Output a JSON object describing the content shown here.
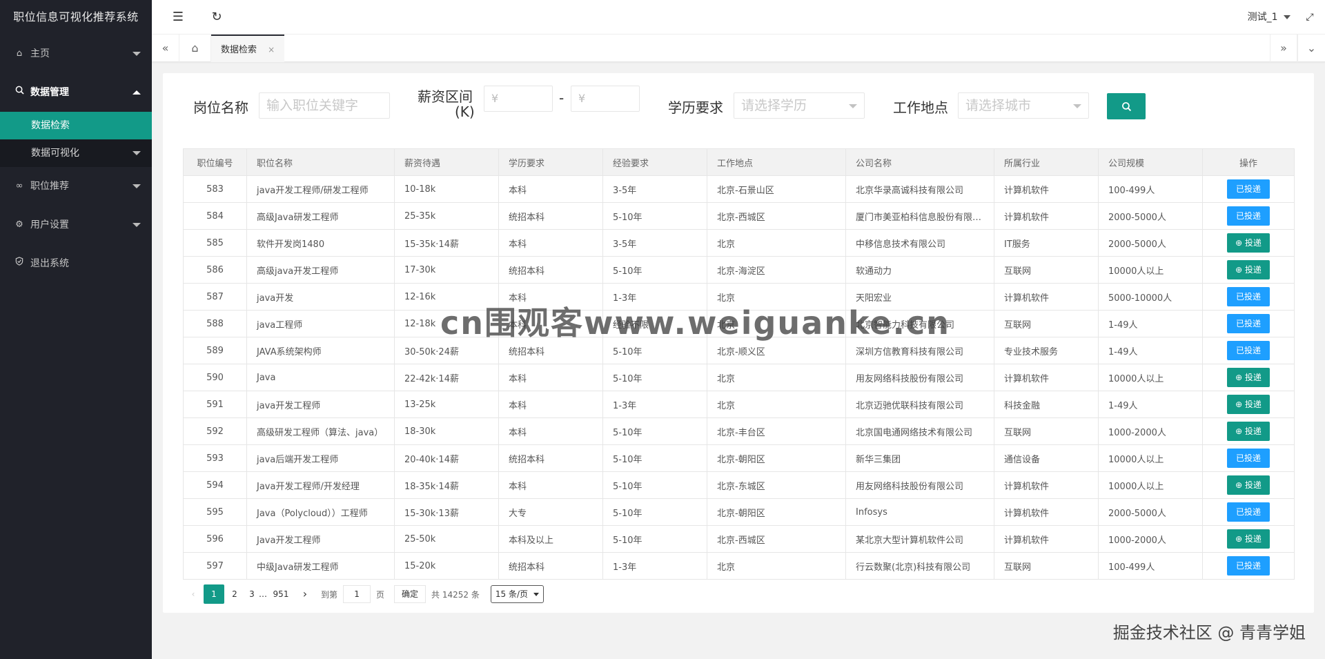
{
  "brand": "职位信息可视化推荐系统",
  "sidebar": {
    "items": [
      {
        "label": "主页",
        "icon": "home-icon"
      },
      {
        "label": "数据管理",
        "icon": "search-icon"
      },
      {
        "label": "职位推荐",
        "icon": "link-icon"
      },
      {
        "label": "用户设置",
        "icon": "gear-icon"
      },
      {
        "label": "退出系统",
        "icon": "shield-icon"
      }
    ],
    "sub": {
      "active": "数据检索",
      "second": "数据可视化"
    }
  },
  "header": {
    "user": "测试_1"
  },
  "tabs": {
    "active": "数据检索",
    "close": "×"
  },
  "filter": {
    "job_label": "岗位名称",
    "job_placeholder": "输入职位关键字",
    "salary_label_1": "薪资区间",
    "salary_label_2": "(K)",
    "salary_min_placeholder": "¥",
    "salary_max_placeholder": "¥",
    "dash": "-",
    "edu_label": "学历要求",
    "edu_placeholder": "请选择学历",
    "city_label": "工作地点",
    "city_placeholder": "请选择城市"
  },
  "table": {
    "headers": [
      "职位编号",
      "职位名称",
      "薪资待遇",
      "学历要求",
      "经验要求",
      "工作地点",
      "公司名称",
      "所属行业",
      "公司规模",
      "操作"
    ],
    "sent_label": "已投递",
    "apply_label": "⊕ 投递",
    "rows": [
      {
        "id": "583",
        "name": "java开发工程师/研发工程师",
        "salary": "10-18k",
        "edu": "本科",
        "exp": "3-5年",
        "city": "北京-石景山区",
        "company": "北京华录高诚科技有限公司",
        "industry": "计算机软件",
        "size": "100-499人",
        "status": "sent"
      },
      {
        "id": "584",
        "name": "高级Java研发工程师",
        "salary": "25-35k",
        "edu": "统招本科",
        "exp": "5-10年",
        "city": "北京-西城区",
        "company": "厦门市美亚柏科信息股份有限公司",
        "industry": "计算机软件",
        "size": "2000-5000人",
        "status": "sent"
      },
      {
        "id": "585",
        "name": "软件开发岗1480",
        "salary": "15-35k·14薪",
        "edu": "本科",
        "exp": "3-5年",
        "city": "北京",
        "company": "中移信息技术有限公司",
        "industry": "IT服务",
        "size": "2000-5000人",
        "status": "apply"
      },
      {
        "id": "586",
        "name": "高级java开发工程师",
        "salary": "17-30k",
        "edu": "统招本科",
        "exp": "5-10年",
        "city": "北京-海淀区",
        "company": "软通动力",
        "industry": "互联网",
        "size": "10000人以上",
        "status": "apply"
      },
      {
        "id": "587",
        "name": "java开发",
        "salary": "12-16k",
        "edu": "本科",
        "exp": "1-3年",
        "city": "北京",
        "company": "天阳宏业",
        "industry": "计算机软件",
        "size": "5000-10000人",
        "status": "sent"
      },
      {
        "id": "588",
        "name": "java工程师",
        "salary": "12-18k",
        "edu": "本科",
        "exp": "经验不限",
        "city": "北京",
        "company": "北京智能力科技有限公司",
        "industry": "互联网",
        "size": "1-49人",
        "status": "sent"
      },
      {
        "id": "589",
        "name": "JAVA系统架构师",
        "salary": "30-50k·24薪",
        "edu": "统招本科",
        "exp": "5-10年",
        "city": "北京-顺义区",
        "company": "深圳方信教育科技有限公司",
        "industry": "专业技术服务",
        "size": "1-49人",
        "status": "sent"
      },
      {
        "id": "590",
        "name": "Java",
        "salary": "22-42k·14薪",
        "edu": "本科",
        "exp": "5-10年",
        "city": "北京",
        "company": "用友网络科技股份有限公司",
        "industry": "计算机软件",
        "size": "10000人以上",
        "status": "apply"
      },
      {
        "id": "591",
        "name": "java开发工程师",
        "salary": "13-25k",
        "edu": "本科",
        "exp": "1-3年",
        "city": "北京",
        "company": "北京迈驰优联科技有限公司",
        "industry": "科技金融",
        "size": "1-49人",
        "status": "apply"
      },
      {
        "id": "592",
        "name": "高级研发工程师（算法、java）",
        "salary": "18-30k",
        "edu": "本科",
        "exp": "5-10年",
        "city": "北京-丰台区",
        "company": "北京国电通网络技术有限公司",
        "industry": "互联网",
        "size": "1000-2000人",
        "status": "apply"
      },
      {
        "id": "593",
        "name": "java后端开发工程师",
        "salary": "20-40k·14薪",
        "edu": "统招本科",
        "exp": "5-10年",
        "city": "北京-朝阳区",
        "company": "新华三集团",
        "industry": "通信设备",
        "size": "10000人以上",
        "status": "sent"
      },
      {
        "id": "594",
        "name": "Java开发工程师/开发经理",
        "salary": "18-35k·14薪",
        "edu": "本科",
        "exp": "5-10年",
        "city": "北京-东城区",
        "company": "用友网络科技股份有限公司",
        "industry": "计算机软件",
        "size": "10000人以上",
        "status": "apply"
      },
      {
        "id": "595",
        "name": "Java（Polycloud））工程师",
        "salary": "15-30k·13薪",
        "edu": "大专",
        "exp": "5-10年",
        "city": "北京-朝阳区",
        "company": "Infosys",
        "industry": "计算机软件",
        "size": "2000-5000人",
        "status": "sent"
      },
      {
        "id": "596",
        "name": "Java开发工程师",
        "salary": "25-50k",
        "edu": "本科及以上",
        "exp": "5-10年",
        "city": "北京-西城区",
        "company": "某北京大型计算机软件公司",
        "industry": "计算机软件",
        "size": "1000-2000人",
        "status": "apply"
      },
      {
        "id": "597",
        "name": "中级Java研发工程师",
        "salary": "15-20k",
        "edu": "统招本科",
        "exp": "1-3年",
        "city": "北京",
        "company": "行云数聚(北京)科技有限公司",
        "industry": "互联网",
        "size": "100-499人",
        "status": "sent"
      }
    ]
  },
  "pager": {
    "prev": "‹",
    "p1": "1",
    "p2": "2",
    "p3": "3",
    "ellipsis": "…",
    "last": "951",
    "next": "›",
    "goto": "到第",
    "page_value": "1",
    "page_unit": "页",
    "ok": "确定",
    "total": "共 14252 条",
    "limit": "15 条/页"
  },
  "watermark": "cn围观客www.weiguanke.cn",
  "credit": "掘金技术社区 @ 青青学姐",
  "colors": {
    "primary": "#129a88",
    "sent": "#1e9fff",
    "sidebar": "#20222a"
  }
}
